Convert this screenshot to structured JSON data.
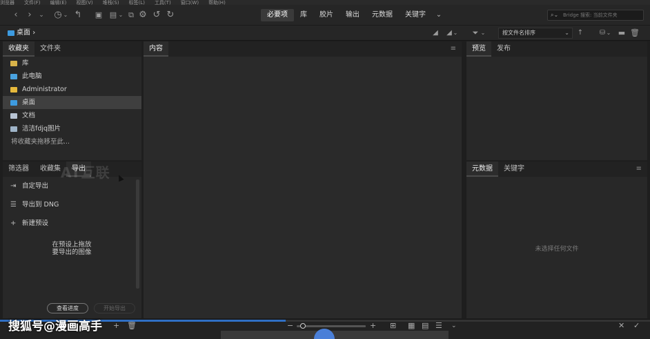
{
  "menubar": {
    "items": [
      "浏览器",
      "文件(F)",
      "编辑(E)",
      "视图(V)",
      "堆栈(S)",
      "标签(L)",
      "工具(T)",
      "窗口(W)",
      "帮助(H)"
    ]
  },
  "workspace_tabs": [
    {
      "label": "必要项",
      "active": true
    },
    {
      "label": "库",
      "active": false
    },
    {
      "label": "胶片",
      "active": false
    },
    {
      "label": "输出",
      "active": false
    },
    {
      "label": "元数据",
      "active": false
    },
    {
      "label": "关键字",
      "active": false
    }
  ],
  "search": {
    "placeholder": "Bridge 搜索: 当前文件夹"
  },
  "path": {
    "current": "桌面",
    "separator": "›"
  },
  "sort": {
    "label": "按文件名排序"
  },
  "left_top_panel": {
    "tabs": [
      {
        "label": "收藏夹",
        "active": true
      },
      {
        "label": "文件夹",
        "active": false
      }
    ],
    "items": [
      {
        "label": "库",
        "icon": "library-icon",
        "color": "#d8b34a",
        "selected": false
      },
      {
        "label": "此电脑",
        "icon": "computer-icon",
        "color": "#4aa3e0",
        "selected": false
      },
      {
        "label": "Administrator",
        "icon": "user-folder-icon",
        "color": "#e6b93c",
        "selected": false
      },
      {
        "label": "桌面",
        "icon": "desktop-folder-icon",
        "color": "#3d9be0",
        "selected": true
      },
      {
        "label": "文档",
        "icon": "document-icon",
        "color": "#b8c4d4",
        "selected": false
      },
      {
        "label": "洁洁fdjq图片",
        "icon": "picture-icon",
        "color": "#9fb4c8",
        "selected": false
      }
    ],
    "hint": "将收藏夹拖移至此..."
  },
  "left_bottom_panel": {
    "tabs": [
      {
        "label": "筛选器",
        "active": false
      },
      {
        "label": "收藏集",
        "active": false
      },
      {
        "label": "导出",
        "active": true
      }
    ],
    "items": [
      {
        "label": "自定导出",
        "icon": "export-icon"
      },
      {
        "label": "导出到 DNG",
        "icon": "list-icon"
      },
      {
        "label": "新建预设",
        "icon": "plus-icon"
      }
    ],
    "drop_hint_line1": "在预设上拖放",
    "drop_hint_line2": "要导出的图像",
    "view_progress_button": "查看进度",
    "start_export_button": "开始导出"
  },
  "content_panel": {
    "tab": "内容"
  },
  "right_top_panel": {
    "tabs": [
      {
        "label": "预览",
        "active": true
      },
      {
        "label": "发布",
        "active": false
      }
    ]
  },
  "right_bottom_panel": {
    "tabs": [
      {
        "label": "元数据",
        "active": true
      },
      {
        "label": "关键字",
        "active": false
      }
    ],
    "empty_text": "未选择任何文件"
  },
  "status": {
    "progress": 0.44
  },
  "watermark": "AT互联",
  "credit": "搜狐号@漫画高手",
  "colors": {
    "accent": "#2f6fc4",
    "folder": "#3d9be0",
    "bg": "#1e1e1e",
    "panel": "#282828"
  }
}
